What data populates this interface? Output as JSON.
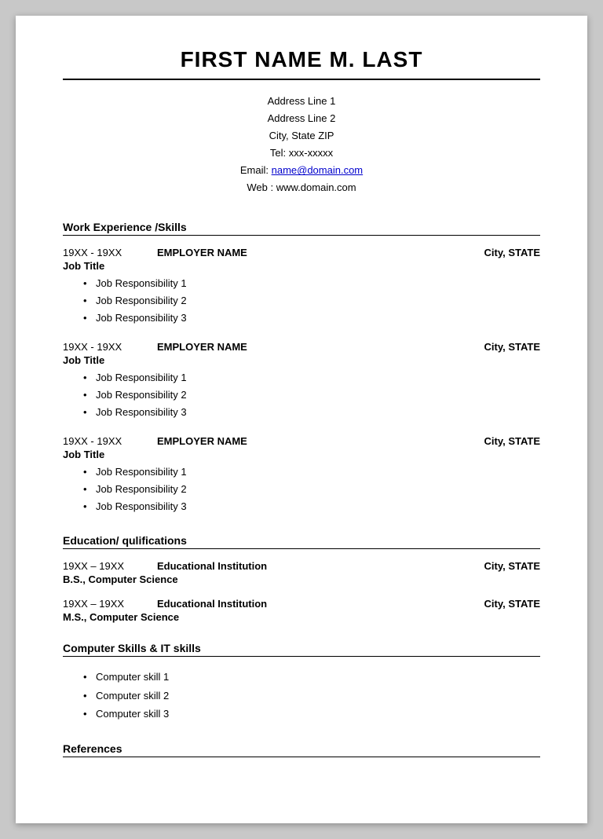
{
  "header": {
    "name": "FIRST NAME M. LAST",
    "address_line1": "Address Line 1",
    "address_line2": "Address Line 2",
    "city_state_zip": "City, State ZIP",
    "tel_label": "Tel:",
    "tel_value": "xxx-xxxxx",
    "email_label": "Email:",
    "email_link_text": "name@domain.com",
    "email_link_href": "mailto:name@domain.com",
    "web_label": "Web :",
    "web_value": "www.domain.com"
  },
  "sections": {
    "work_experience": {
      "title": "Work Experience /Skills",
      "jobs": [
        {
          "dates": "19XX - 19XX",
          "employer": "EMPLOYER NAME",
          "location": "City, STATE",
          "title": "Job Title",
          "responsibilities": [
            "Job Responsibility 1",
            "Job Responsibility 2",
            "Job Responsibility 3"
          ]
        },
        {
          "dates": "19XX - 19XX",
          "employer": "EMPLOYER NAME",
          "location": "City, STATE",
          "title": "Job Title",
          "responsibilities": [
            "Job Responsibility 1",
            "Job Responsibility 2",
            "Job Responsibility 3"
          ]
        },
        {
          "dates": "19XX - 19XX",
          "employer": "EMPLOYER NAME",
          "location": "City, STATE",
          "title": "Job Title",
          "responsibilities": [
            "Job Responsibility 1",
            "Job Responsibility 2",
            "Job Responsibility 3"
          ]
        }
      ]
    },
    "education": {
      "title": "Education/ qulifications",
      "entries": [
        {
          "dates": "19XX – 19XX",
          "institution": "Educational Institution",
          "location": "City, STATE",
          "degree": "B.S., Computer Science"
        },
        {
          "dates": "19XX – 19XX",
          "institution": "Educational Institution",
          "location": "City, STATE",
          "degree": "M.S., Computer Science"
        }
      ]
    },
    "computer_skills": {
      "title": "Computer Skills & IT skills",
      "skills": [
        "Computer skill 1",
        "Computer skill 2",
        "Computer skill 3"
      ]
    },
    "references": {
      "title": "References"
    }
  }
}
